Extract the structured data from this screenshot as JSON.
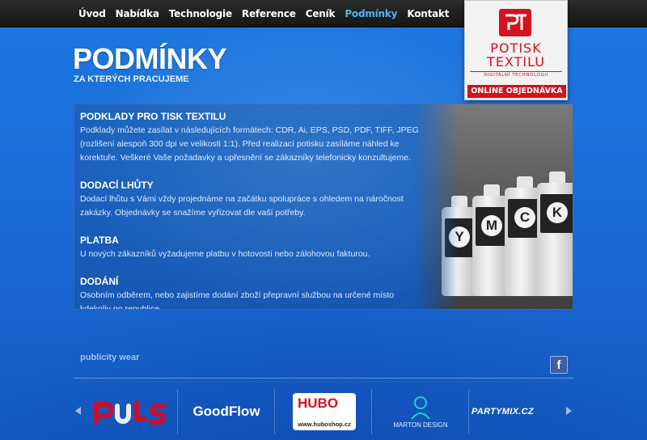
{
  "nav": {
    "items": [
      {
        "label": "Úvod",
        "active": false
      },
      {
        "label": "Nabídka",
        "active": false
      },
      {
        "label": "Technologie",
        "active": false
      },
      {
        "label": "Reference",
        "active": false
      },
      {
        "label": "Ceník",
        "active": false
      },
      {
        "label": "Podmínky",
        "active": true
      },
      {
        "label": "Kontakt",
        "active": false
      }
    ],
    "active_color": "#4fb3ff"
  },
  "logo": {
    "title": "POTISK TEXTILU",
    "subtitle": "DIGITÁLNÍ TECHNOLOGII",
    "order_button": "ONLINE OBJEDNÁVKA",
    "brand_color": "#d31222"
  },
  "page": {
    "title": "PODMÍNKY",
    "subtitle": "ZA KTERÝCH PRACUJEME"
  },
  "sections": [
    {
      "heading": "PODKLADY PRO TISK TEXTILU",
      "body": "Podklady můžete zasílat v následujících formátech: CDR, Ai, EPS, PSD, PDF, TIFF, JPEG (rozlišení alespoň 300 dpi ve velikosti 1:1). Před realizací potisku zasíláme náhled ke korektuře. Veškeré Vaše požadavky a upřesnění se zákazníky telefonicky konzultujeme."
    },
    {
      "heading": "DODACÍ LHŮTY",
      "body": "Dodací lhůtu s Vámi vždy projednáme na začátku spolupráce s ohledem na náročnost zakázky. Objednávky se snažíme vyřizovat dle vaší potřeby."
    },
    {
      "heading": "PLATBA",
      "body": "U nových zákazníků vyžadujeme platbu v hotovosti nebo zálohovou fakturou."
    },
    {
      "heading": "DODÁNÍ",
      "body": "Osobním odběrem, nebo zajistíme dodání zboží přepravní službou na určené místo kdekoliv po republice."
    }
  ],
  "photo": {
    "bottles": [
      {
        "letter": "Y"
      },
      {
        "letter": "M"
      },
      {
        "letter": "C"
      },
      {
        "letter": "K"
      }
    ]
  },
  "footer": {
    "brand": "publicity wear",
    "facebook": "f",
    "partners": [
      {
        "name": "PULS",
        "color": "#c8102e"
      },
      {
        "name": "GoodFlow",
        "color": "#ffffff"
      },
      {
        "name": "HUBO",
        "color": "#d31222"
      },
      {
        "name": "MARTON DESIGN",
        "color": "#ffffff"
      },
      {
        "name": "PARTYMIX.CZ",
        "color": "#ffffff"
      }
    ],
    "hubo_url": "www.huboshop.cz"
  }
}
